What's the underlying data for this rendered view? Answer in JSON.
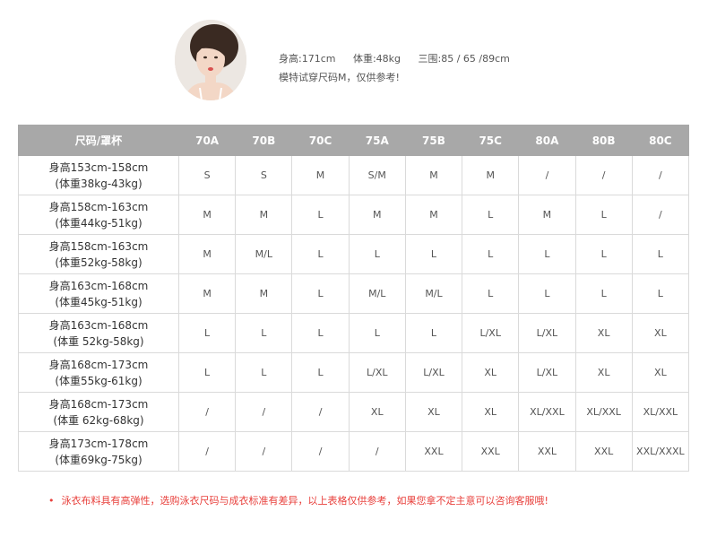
{
  "model": {
    "height_label": "身高:171cm",
    "weight_label": "体重:48kg",
    "measure_label": "三围:85 / 65 /89cm",
    "note": "模特试穿尺码M，仅供参考!"
  },
  "table": {
    "header_label": "尺码/罩杯",
    "columns": [
      "70A",
      "70B",
      "70C",
      "75A",
      "75B",
      "75C",
      "80A",
      "80B",
      "80C"
    ],
    "rows": [
      {
        "line1": "身高153cm-158cm",
        "line2": "(体重38kg-43kg)",
        "cells": [
          "S",
          "S",
          "M",
          "S/M",
          "M",
          "M",
          "/",
          "/",
          "/"
        ]
      },
      {
        "line1": "身高158cm-163cm",
        "line2": "(体重44kg-51kg)",
        "cells": [
          "M",
          "M",
          "L",
          "M",
          "M",
          "L",
          "M",
          "L",
          "/"
        ]
      },
      {
        "line1": "身高158cm-163cm",
        "line2": "(体重52kg-58kg)",
        "cells": [
          "M",
          "M/L",
          "L",
          "L",
          "L",
          "L",
          "L",
          "L",
          "L"
        ]
      },
      {
        "line1": "身高163cm-168cm",
        "line2": "(体重45kg-51kg)",
        "cells": [
          "M",
          "M",
          "L",
          "M/L",
          "M/L",
          "L",
          "L",
          "L",
          "L"
        ]
      },
      {
        "line1": "身高163cm-168cm",
        "line2": "(体重 52kg-58kg)",
        "cells": [
          "L",
          "L",
          "L",
          "L",
          "L",
          "L/XL",
          "L/XL",
          "XL",
          "XL"
        ]
      },
      {
        "line1": "身高168cm-173cm",
        "line2": "(体重55kg-61kg)",
        "cells": [
          "L",
          "L",
          "L",
          "L/XL",
          "L/XL",
          "XL",
          "L/XL",
          "XL",
          "XL"
        ]
      },
      {
        "line1": "身高168cm-173cm",
        "line2": "(体重 62kg-68kg)",
        "cells": [
          "/",
          "/",
          "/",
          "XL",
          "XL",
          "XL",
          "XL/XXL",
          "XL/XXL",
          "XL/XXL"
        ]
      },
      {
        "line1": "身高173cm-178cm",
        "line2": "(体重69kg-75kg)",
        "cells": [
          "/",
          "/",
          "/",
          "/",
          "XXL",
          "XXL",
          "XXL",
          "XXL",
          "XXL/XXXL"
        ]
      }
    ]
  },
  "footer": {
    "bullet": "•",
    "note": "泳衣布料具有高弹性，选购泳衣尺码与成衣标准有差异，以上表格仅供参考，如果您拿不定主意可以咨询客服哦!"
  },
  "colors": {
    "header_bg": "#a8a8a8",
    "note_red": "#e8403c",
    "grid": "#dadada"
  }
}
